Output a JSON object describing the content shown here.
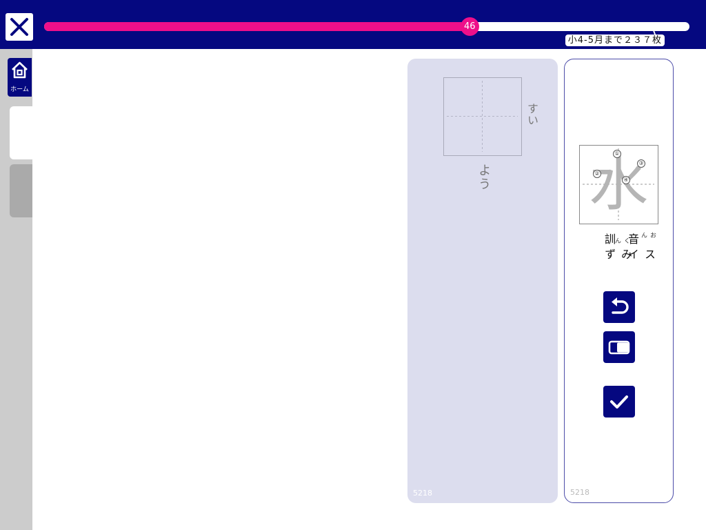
{
  "header": {
    "progress": {
      "value": 46,
      "fraction": 0.659
    },
    "goal_label": "小4-5月まで２３７枚"
  },
  "sidebar": {
    "home_label": "ホーム"
  },
  "practice_card": {
    "reading_right": "すい",
    "reading_below": "よう",
    "card_number": "5218"
  },
  "kanji_card": {
    "character": "水",
    "stroke_numbers": [
      "①",
      "②",
      "③",
      "④"
    ],
    "on_label": "音",
    "on_ruby": "おん",
    "on_reading": "スイ",
    "kun_label": "訓",
    "kun_ruby": "くん",
    "kun_reading": "みず",
    "card_number": "5218"
  },
  "colors": {
    "navy": "#050880",
    "accent_pink": "#ee0f8a",
    "panel_lavender": "#dcddee"
  },
  "icons": [
    "close-icon",
    "home-icon",
    "undo-icon",
    "eraser-icon",
    "check-icon"
  ]
}
